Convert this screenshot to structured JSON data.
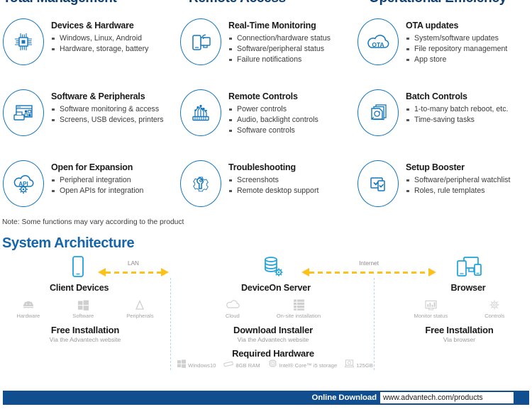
{
  "section_headings": [
    "Total Management",
    "Remote Access",
    "Operational Efficiency"
  ],
  "colors": {
    "heading_blue": "#0d3f73",
    "accent_blue": "#1476bc",
    "title_blue": "#1665ab",
    "bar_blue": "#114e8f",
    "arrow_yellow": "#fcc11a"
  },
  "features": [
    {
      "icon": "cpu-chip-icon",
      "title": "Devices & Hardware",
      "bullets": [
        "Windows, Linux, Android",
        "Hardware, storage, battery"
      ]
    },
    {
      "icon": "mobile-monitoring-icon",
      "title": "Real-Time Monitoring",
      "bullets": [
        "Connection/hardware status",
        "Software/peripheral status",
        "Failure notifications"
      ]
    },
    {
      "icon": "ota-cloud-icon",
      "title": "OTA updates",
      "bullets": [
        "System/software updates",
        "File repository management",
        "App store"
      ]
    },
    {
      "icon": "software-printer-icon",
      "title": "Software & Peripherals",
      "bullets": [
        "Software monitoring & access",
        "Screens, USB devices, printers"
      ]
    },
    {
      "icon": "circuit-controls-icon",
      "title": "Remote Controls",
      "bullets": [
        "Power controls",
        "Audio, backlight controls",
        "Software controls"
      ]
    },
    {
      "icon": "batch-documents-icon",
      "title": "Batch Controls",
      "bullets": [
        "1-to-many batch reboot, etc.",
        "Time-saving tasks"
      ]
    },
    {
      "icon": "api-cloud-gear-icon",
      "title": "Open for Expansion",
      "bullets": [
        "Peripheral integration",
        "Open APIs for integration"
      ]
    },
    {
      "icon": "gear-wrench-icon",
      "title": "Troubleshooting",
      "bullets": [
        "Screenshots",
        "Remote desktop support"
      ]
    },
    {
      "icon": "devices-check-icon",
      "title": "Setup Booster",
      "bullets": [
        "Software/peripheral watchlist",
        "Roles, rule templates"
      ]
    }
  ],
  "note": "Note: Some functions may vary according to the product",
  "architecture": {
    "title": "System Architecture",
    "nodes": {
      "client": {
        "label": "Client Devices",
        "icon": "tablet-icon"
      },
      "server": {
        "label": "DeviceOn Server",
        "icon": "database-gear-icon"
      },
      "browser": {
        "label": "Browser",
        "icon": "multi-device-browser-icon"
      }
    },
    "links": [
      {
        "label": "LAN"
      },
      {
        "label": "Internet"
      }
    ],
    "client_sub": [
      {
        "icon": "android-icon",
        "label": "Hardware"
      },
      {
        "icon": "windows-icon",
        "label": "Software"
      },
      {
        "icon": "peripheral-icon",
        "label": "Peripherals"
      }
    ],
    "server_sub": [
      {
        "icon": "cloud-icon",
        "label": "Cloud"
      },
      {
        "icon": "server-rack-icon",
        "label": "On-site installation"
      }
    ],
    "browser_sub": [
      {
        "icon": "monitor-status-icon",
        "label": "Monitor status"
      },
      {
        "icon": "controls-gear-icon",
        "label": "Controls"
      }
    ],
    "client_block": {
      "title": "Free Installation",
      "subtitle": "Via the Advantech website"
    },
    "server_block": {
      "title": "Download Installer",
      "subtitle": "Via the Advantech website"
    },
    "browser_block": {
      "title": "Free Installation",
      "subtitle": "Via browser"
    },
    "required_hardware_title": "Required Hardware",
    "required_hardware": [
      {
        "icon": "windows-icon",
        "label": "Windows10"
      },
      {
        "icon": "ram-icon",
        "label": "8GB RAM"
      },
      {
        "icon": "cpu-icon",
        "label": "Intel® Core™ i5 storage"
      },
      {
        "icon": "hdd-icon",
        "label": "125GB"
      }
    ]
  },
  "footer": {
    "label": "Online Download",
    "url": "www.advantech.com/products"
  }
}
